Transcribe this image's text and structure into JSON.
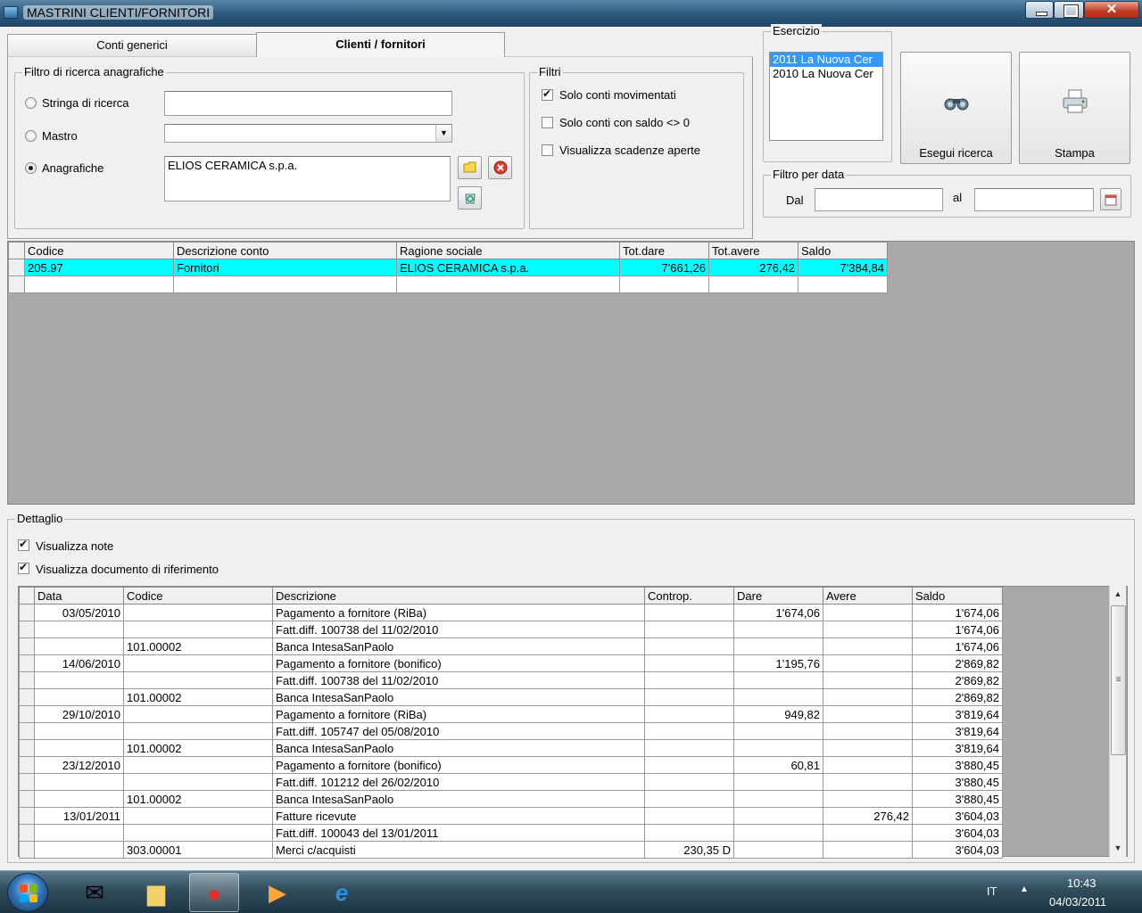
{
  "window": {
    "title": "MASTRINI CLIENTI/FORNITORI"
  },
  "tabs": [
    {
      "label": "Conti generici"
    },
    {
      "label": "Clienti / fornitori"
    }
  ],
  "filtro_anagrafiche": {
    "legend": "Filtro di ricerca anagrafiche",
    "stringa_label": "Stringa di ricerca",
    "stringa_value": "",
    "mastro_label": "Mastro",
    "mastro_value": "",
    "anagrafiche_label": "Anagrafiche",
    "anagrafiche_value": "ELIOS CERAMICA s.p.a."
  },
  "filtri": {
    "legend": "Filtri",
    "solo_movimentati": "Solo conti movimentati",
    "solo_saldo": "Solo conti con saldo <> 0",
    "scadenze": "Visualizza scadenze aperte"
  },
  "esercizio": {
    "legend": "Esercizio",
    "items": [
      "2011 La Nuova Cer",
      "2010 La Nuova Cer"
    ]
  },
  "buttons": {
    "esegui": "Esegui ricerca",
    "stampa": "Stampa"
  },
  "filtro_data": {
    "legend": "Filtro per data",
    "dal_label": "Dal",
    "al_label": "al",
    "dal_value": "",
    "al_value": ""
  },
  "conti_grid": {
    "headers": [
      "Codice",
      "Descrizione conto",
      "Ragione sociale",
      "Tot.dare",
      "Tot.avere",
      "Saldo"
    ],
    "rows": [
      [
        "205.97",
        "Fornitori",
        "ELIOS CERAMICA s.p.a.",
        "7'661,26",
        "276,42",
        "7'384,84"
      ],
      [
        "",
        "",
        "",
        "",
        "",
        ""
      ]
    ]
  },
  "dettaglio": {
    "legend": "Dettaglio",
    "visualizza_note": "Visualizza note",
    "visualizza_doc": "Visualizza documento di riferimento",
    "headers": [
      "Data",
      "Codice",
      "Descrizione",
      "Controp.",
      "Dare",
      "Avere",
      "Saldo"
    ],
    "rows": [
      [
        "03/05/2010",
        "",
        "Pagamento a fornitore (RiBa)",
        "",
        "1'674,06",
        "",
        "1'674,06"
      ],
      [
        "",
        "",
        "Fatt.diff. 100738 del 11/02/2010",
        "",
        "",
        "",
        "1'674,06"
      ],
      [
        "",
        "101.00002",
        "Banca IntesaSanPaolo",
        "",
        "",
        "",
        "1'674,06"
      ],
      [
        "14/06/2010",
        "",
        "Pagamento a fornitore (bonifico)",
        "",
        "1'195,76",
        "",
        "2'869,82"
      ],
      [
        "",
        "",
        "Fatt.diff. 100738 del 11/02/2010",
        "",
        "",
        "",
        "2'869,82"
      ],
      [
        "",
        "101.00002",
        "Banca IntesaSanPaolo",
        "",
        "",
        "",
        "2'869,82"
      ],
      [
        "29/10/2010",
        "",
        "Pagamento a fornitore (RiBa)",
        "",
        "949,82",
        "",
        "3'819,64"
      ],
      [
        "",
        "",
        "Fatt.diff. 105747 del 05/08/2010",
        "",
        "",
        "",
        "3'819,64"
      ],
      [
        "",
        "101.00002",
        "Banca IntesaSanPaolo",
        "",
        "",
        "",
        "3'819,64"
      ],
      [
        "23/12/2010",
        "",
        "Pagamento a fornitore (bonifico)",
        "",
        "60,81",
        "",
        "3'880,45"
      ],
      [
        "",
        "",
        "Fatt.diff. 101212 del 26/02/2010",
        "",
        "",
        "",
        "3'880,45"
      ],
      [
        "",
        "101.00002",
        "Banca IntesaSanPaolo",
        "",
        "",
        "",
        "3'880,45"
      ],
      [
        "13/01/2011",
        "",
        "Fatture ricevute",
        "",
        "",
        "276,42",
        "3'604,03"
      ],
      [
        "",
        "",
        "Fatt.diff. 100043 del 13/01/2011",
        "",
        "",
        "",
        "3'604,03"
      ],
      [
        "",
        "303.00001",
        "Merci c/acquisti",
        "230,35 D",
        "",
        "",
        "3'604,03"
      ]
    ]
  },
  "taskbar": {
    "lang": "IT",
    "time": "10:43",
    "date": "04/03/2011"
  },
  "colors": {
    "highlight": "#00ffff",
    "selection": "#3399ff"
  }
}
